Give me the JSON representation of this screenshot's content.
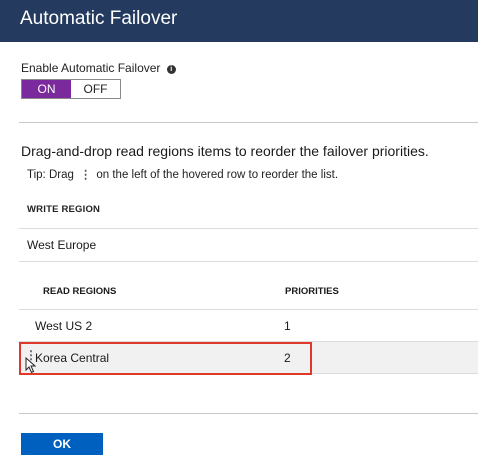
{
  "header": {
    "title": "Automatic Failover"
  },
  "enable": {
    "label": "Enable Automatic Failover",
    "info_icon": "i",
    "toggle_on": "ON",
    "toggle_off": "OFF",
    "selected": "ON"
  },
  "instruction": "Drag-and-drop read regions items to reorder the failover priorities.",
  "tip": {
    "prefix": "Tip: Drag",
    "grip": "⋮",
    "suffix": "on the left of the hovered row to reorder the list."
  },
  "write_region": {
    "header": "WRITE REGION",
    "value": "West Europe"
  },
  "read_regions": {
    "header_name": "READ REGIONS",
    "header_priority": "PRIORITIES",
    "rows": [
      {
        "name": "West US 2",
        "priority": "1"
      },
      {
        "name": "Korea Central",
        "priority": "2"
      }
    ]
  },
  "drag_grip": "⋮",
  "footer": {
    "ok_label": "OK"
  },
  "colors": {
    "header_bg": "#243a5e",
    "toggle_on_bg": "#7b2a9e",
    "ok_bg": "#0060c0",
    "highlight": "#e0392b"
  }
}
